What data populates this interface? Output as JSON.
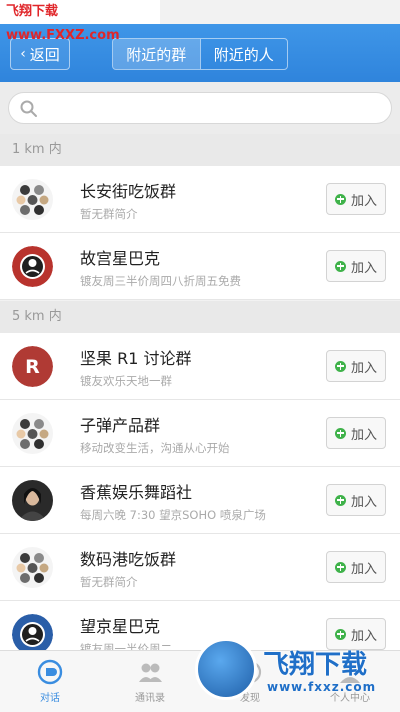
{
  "watermark_top": "飞翔下载 www.FXXZ.com",
  "header": {
    "back_label": "返回",
    "segments": [
      "附近的群",
      "附近的人"
    ],
    "active_segment": 0
  },
  "search": {
    "placeholder": ""
  },
  "sections": [
    {
      "label": "1 km 内",
      "rows": [
        {
          "title": "长安街吃饭群",
          "subtitle": "暂无群简介",
          "avatar": "group-collage-icon",
          "join_label": "加入"
        },
        {
          "title": "故宫星巴克",
          "subtitle": "镀友周三半价周四八折周五免费",
          "avatar": "starbucks-logo-icon",
          "join_label": "加入"
        }
      ]
    },
    {
      "label": "5 km 内",
      "rows": [
        {
          "title": "坚果 R1 讨论群",
          "subtitle": "镀友欢乐天地一群",
          "avatar": "letter-r-icon",
          "join_label": "加入"
        },
        {
          "title": "子弹产品群",
          "subtitle": "移动改变生活，沟通从心开始",
          "avatar": "group-collage-icon",
          "join_label": "加入"
        },
        {
          "title": "香蕉娱乐舞蹈社",
          "subtitle": "每周六晚 7:30 望京SOHO 喷泉广场",
          "avatar": "portrait-icon",
          "join_label": "加入"
        },
        {
          "title": "数码港吃饭群",
          "subtitle": "暂无群简介",
          "avatar": "group-collage-icon",
          "join_label": "加入"
        },
        {
          "title": "望京星巴克",
          "subtitle": "镀友周一半价周二",
          "avatar": "starbucks-logo-icon",
          "join_label": "加入"
        }
      ]
    }
  ],
  "tabbar": [
    {
      "label": "对话",
      "icon": "chat-bubble-icon",
      "active": true
    },
    {
      "label": "通讯录",
      "icon": "contacts-icon",
      "active": false
    },
    {
      "label": "发现",
      "icon": "discover-icon",
      "active": false
    },
    {
      "label": "个人中心",
      "icon": "profile-icon",
      "active": false
    }
  ],
  "watermark_bottom": {
    "brand": "飞翔下载",
    "site": "www.fxxz.com"
  },
  "colors": {
    "header_blue": "#2f84dc",
    "join_green": "#3fb24a",
    "tab_active": "#3a8de0"
  }
}
